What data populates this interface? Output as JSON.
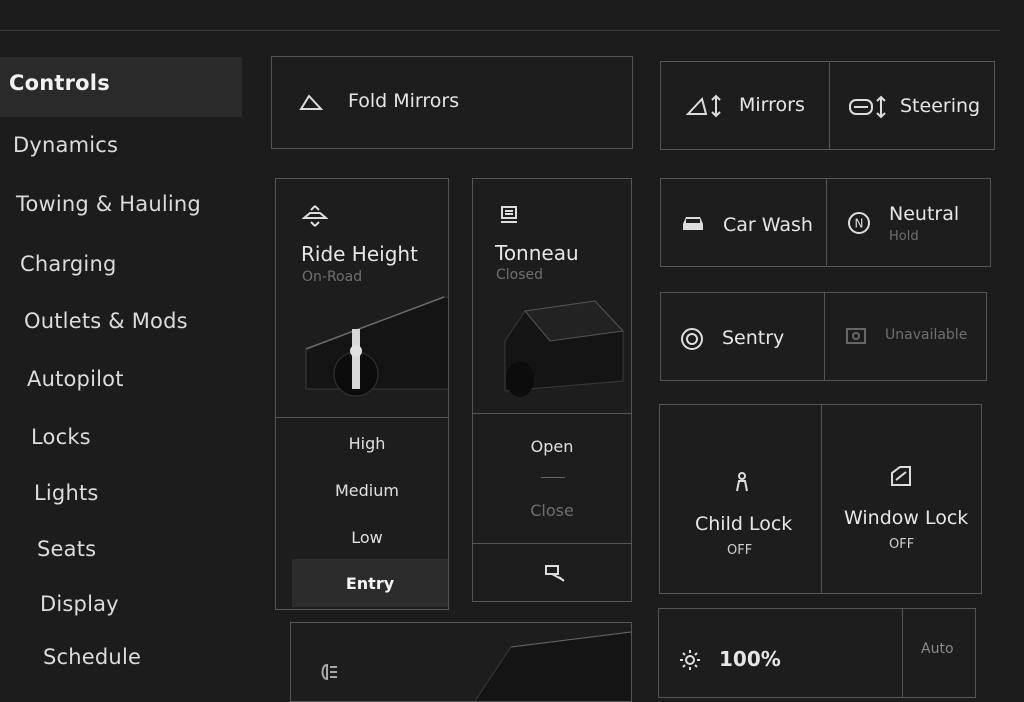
{
  "sidebar": {
    "items": [
      {
        "label": "Controls",
        "active": true
      },
      {
        "label": "Dynamics"
      },
      {
        "label": "Towing & Hauling"
      },
      {
        "label": "Charging"
      },
      {
        "label": "Outlets & Mods"
      },
      {
        "label": "Autopilot"
      },
      {
        "label": "Locks"
      },
      {
        "label": "Lights"
      },
      {
        "label": "Seats"
      },
      {
        "label": "Display"
      },
      {
        "label": "Schedule"
      }
    ]
  },
  "fold_mirrors": {
    "label": "Fold Mirrors",
    "icon": "mirror-icon"
  },
  "mirrors": {
    "label": "Mirrors",
    "icon": "mirror-adjust-icon"
  },
  "steering": {
    "label": "Steering",
    "icon": "steering-adjust-icon"
  },
  "ride_height": {
    "title": "Ride Height",
    "status": "On-Road",
    "options": [
      "High",
      "Medium",
      "Low",
      "Entry"
    ],
    "selected": "Entry"
  },
  "tonneau": {
    "title": "Tonneau",
    "status": "Closed",
    "open_label": "Open",
    "close_label": "Close"
  },
  "car_wash": {
    "label": "Car Wash"
  },
  "neutral": {
    "label": "Neutral",
    "sub": "Hold"
  },
  "sentry": {
    "label": "Sentry"
  },
  "dashcam": {
    "label": "Unavailable"
  },
  "child_lock": {
    "label": "Child Lock",
    "status": "OFF"
  },
  "window_lock": {
    "label": "Window Lock",
    "status": "OFF"
  },
  "brightness": {
    "value": "100%",
    "auto_label": "Auto"
  },
  "colors": {
    "background": "#1c1c1d",
    "panel_border": "#555555",
    "text": "#e6e6e6",
    "muted": "#6f6f6f"
  }
}
